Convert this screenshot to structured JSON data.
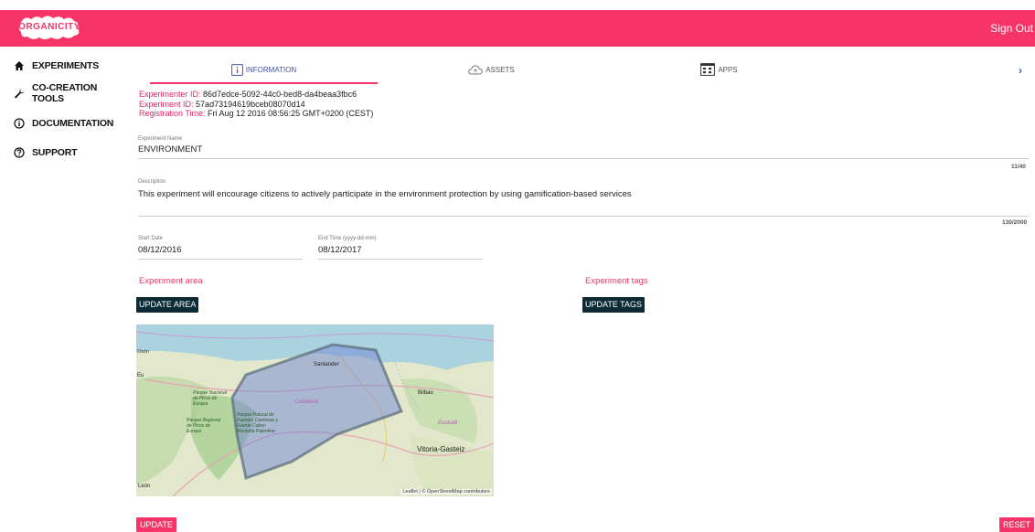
{
  "app": {
    "logo_text": "ORGANICITY",
    "sign_out": "Sign Out",
    "accent": "#f73468",
    "dark": "#0d2b34"
  },
  "sidebar": {
    "items": [
      {
        "label": "EXPERIMENTS",
        "icon": "home-icon"
      },
      {
        "label": "CO-CREATION TOOLS",
        "icon": "wrench-icon"
      },
      {
        "label": "DOCUMENTATION",
        "icon": "info-icon"
      },
      {
        "label": "SUPPORT",
        "icon": "help-icon"
      }
    ]
  },
  "tabs": {
    "items": [
      {
        "label": "INFORMATION",
        "icon": "info-box-icon",
        "active": true
      },
      {
        "label": "ASSETS",
        "icon": "cloud-icon",
        "active": false
      },
      {
        "label": "APPS",
        "icon": "apps-grid-icon",
        "active": false
      }
    ],
    "next": "›"
  },
  "ids": {
    "experimenter_label": "Experimenter ID:",
    "experimenter_value": "86d7edce-5092-44c0-bed8-da4beaa3fbc6",
    "experiment_label": "Experiment ID:",
    "experiment_value": "57ad73194619bceb08070d14",
    "registration_label": "Registration Time:",
    "registration_value": "Fri Aug 12 2016 08:56:25 GMT+0200 (CEST)"
  },
  "form": {
    "name_label": "Experiment Name",
    "name_value": "ENVIRONMENT",
    "name_counter": "11/40",
    "description_label": "Description",
    "description_value": "This experiment will encourage citizens to actively participate in the environment protection by using gamification-based services",
    "description_counter": "130/2000",
    "start_label": "Start Date",
    "start_value": "08/12/2016",
    "end_label": "End Time (yyyy-dd-mm)",
    "end_value": "08/12/2017"
  },
  "area": {
    "title": "Experiment area",
    "button": "UPDATE AREA"
  },
  "tags": {
    "title": "Experiment tags",
    "button": "UPDATE TAGS"
  },
  "map": {
    "labels": [
      "Oxón",
      "Santander",
      "Bilbao",
      "Parque Nacional de Picos de Europa",
      "Parque Natural de Fuentes Carrionas y Fuente Cobre-Montaña Palentina",
      "Parque Regional de Picos de Europa",
      "Cantabria",
      "Euskadi",
      "Vitoria-Gasteiz",
      "León",
      "Eu"
    ],
    "attribution": "Leaflet | © OpenStreetMap contributors"
  },
  "footer": {
    "update": "UPDATE",
    "reset": "RESET"
  }
}
